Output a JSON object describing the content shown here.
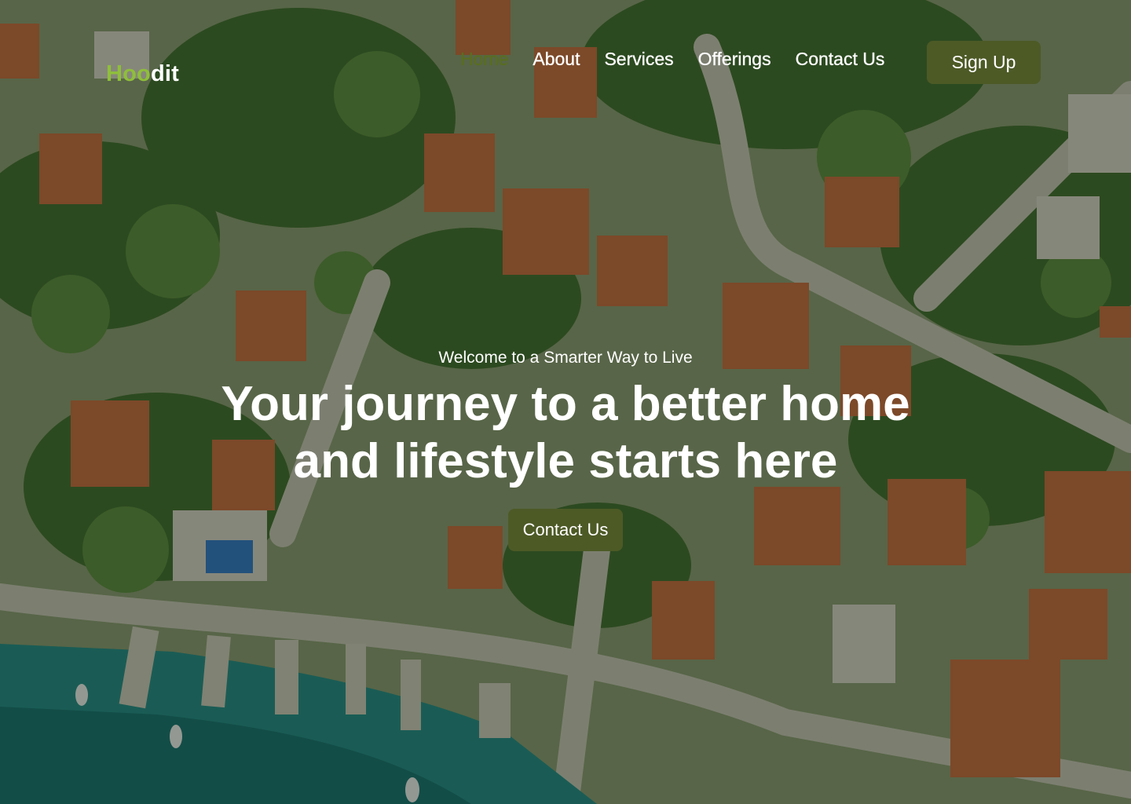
{
  "brand": {
    "logo_part1": "Hoo",
    "logo_part2": "dit"
  },
  "nav": {
    "items": [
      {
        "label": "Home",
        "active": true
      },
      {
        "label": "About",
        "active": false
      },
      {
        "label": "Services",
        "active": false
      },
      {
        "label": "Offerings",
        "active": false
      },
      {
        "label": "Contact Us",
        "active": false
      }
    ],
    "signup_label": "Sign Up"
  },
  "hero": {
    "eyebrow": "Welcome to a Smarter Way to Live",
    "headline": "Your journey to a better home and lifestyle starts here",
    "cta_label": "Contact Us"
  },
  "colors": {
    "accent": "#4d5a26",
    "logo_green": "#8fbf3a",
    "active_nav": "#5a6e1f"
  }
}
